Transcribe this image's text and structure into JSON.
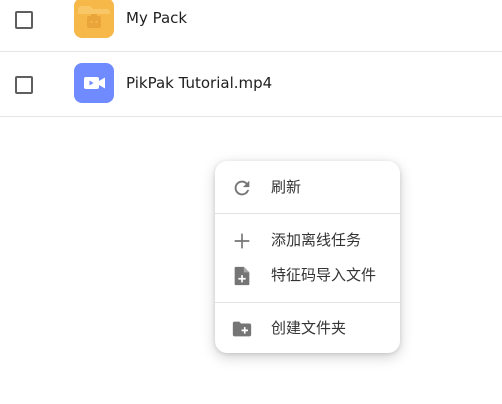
{
  "files": [
    {
      "name": "My Pack",
      "icon": "folder-pack-icon",
      "icon_color": "#F7B84A"
    },
    {
      "name": "PikPak Tutorial.mp4",
      "icon": "video-icon",
      "icon_color": "#6F8BFF"
    }
  ],
  "context_menu": {
    "items": [
      {
        "label": "刷新",
        "icon": "refresh-icon"
      },
      {
        "label": "添加离线任务",
        "icon": "plus-icon"
      },
      {
        "label": "特征码导入文件",
        "icon": "file-add-icon"
      },
      {
        "label": "创建文件夹",
        "icon": "folder-add-icon"
      }
    ]
  },
  "colors": {
    "icon_gray": "#757575",
    "divider": "#e3e3e3"
  }
}
